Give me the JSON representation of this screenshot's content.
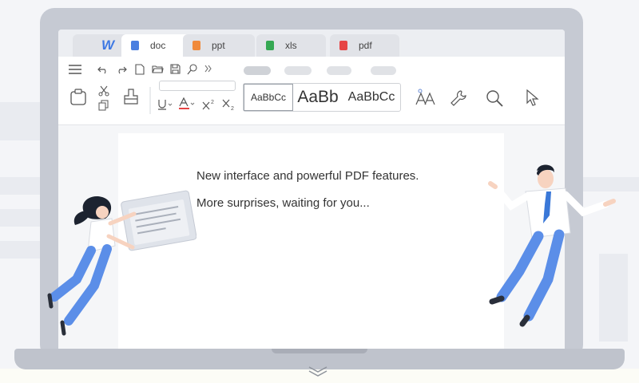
{
  "tabs": [
    {
      "label": "",
      "icon": "wps-logo"
    },
    {
      "label": "doc",
      "icon": "doc-file-icon",
      "color": "#4a7fe0",
      "active": true
    },
    {
      "label": "ppt",
      "icon": "ppt-file-icon",
      "color": "#f08a3b"
    },
    {
      "label": "xls",
      "icon": "xls-file-icon",
      "color": "#35a853"
    },
    {
      "label": "pdf",
      "icon": "pdf-file-icon",
      "color": "#e64545"
    }
  ],
  "logo": "W",
  "styles": {
    "style1": "AaBbCc",
    "style2": "AaBb",
    "style3": "AaBbCc"
  },
  "document": {
    "line1": "New interface and powerful PDF features.",
    "line2": "More surprises, waiting for you..."
  },
  "colors": {
    "accent": "#3d78e3",
    "figure_pants": "#5b8ee8",
    "figure_tie": "#3a78d8"
  }
}
